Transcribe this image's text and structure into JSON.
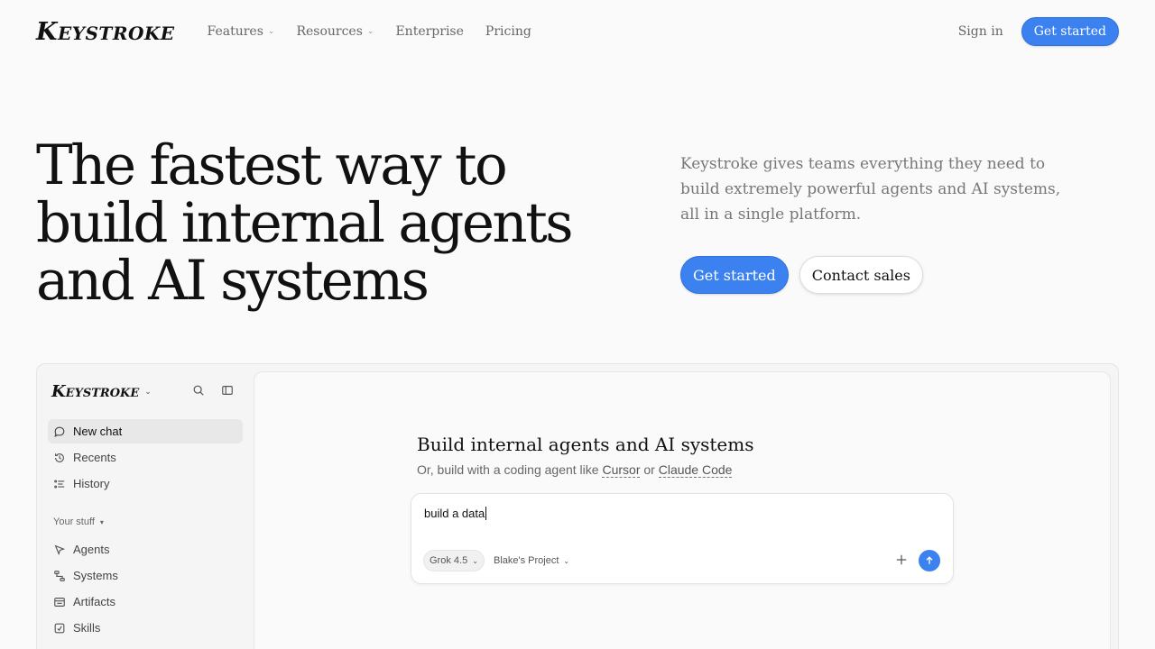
{
  "nav": {
    "logo": {
      "initial": "K",
      "rest": "EYSTROKE"
    },
    "links": [
      {
        "label": "Features",
        "has_dropdown": true
      },
      {
        "label": "Resources",
        "has_dropdown": true
      },
      {
        "label": "Enterprise",
        "has_dropdown": false
      },
      {
        "label": "Pricing",
        "has_dropdown": false
      }
    ],
    "signin": "Sign in",
    "cta": "Get started"
  },
  "hero": {
    "title_lines": [
      "The fastest way to",
      "build internal agents",
      "and AI systems"
    ],
    "description": "Keystroke gives teams everything they need to build extremely powerful agents and AI systems, all in a single platform.",
    "primary_cta": "Get started",
    "secondary_cta": "Contact sales"
  },
  "app": {
    "sidebar": {
      "logo": {
        "initial": "K",
        "rest": "EYSTROKE"
      },
      "items": [
        {
          "label": "New chat",
          "icon": "chat-bubble-icon",
          "active": true
        },
        {
          "label": "Recents",
          "icon": "history-clock-icon"
        },
        {
          "label": "History",
          "icon": "list-icon"
        }
      ],
      "section_label": "Your stuff",
      "section_items": [
        {
          "label": "Agents",
          "icon": "pointer-icon"
        },
        {
          "label": "Systems",
          "icon": "systems-icon"
        },
        {
          "label": "Artifacts",
          "icon": "artifacts-icon"
        },
        {
          "label": "Skills",
          "icon": "skills-icon"
        }
      ]
    },
    "main": {
      "title": "Build internal agents and AI systems",
      "subtitle_prefix": "Or, build with a coding agent like ",
      "link1": "Cursor",
      "subtitle_mid": " or ",
      "link2": "Claude Code",
      "composer_value": "build a data",
      "model": "Grok 4.5",
      "project": "Blake's Project"
    }
  },
  "colors": {
    "accent": "#3b82f0",
    "background": "#fafafa",
    "text": "#111111",
    "muted": "#777777"
  }
}
